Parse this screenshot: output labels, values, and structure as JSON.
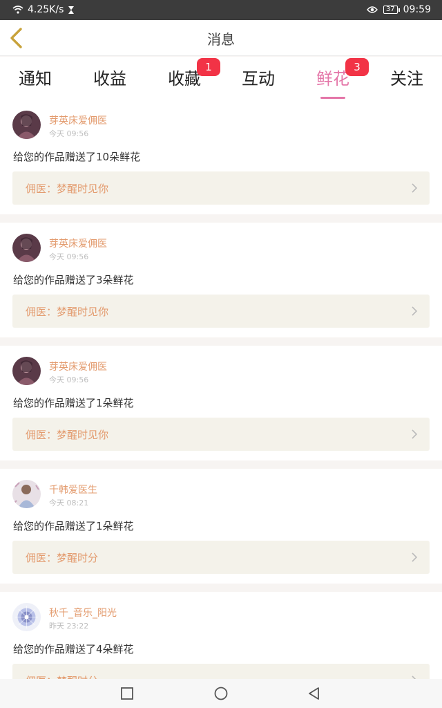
{
  "status": {
    "speed": "4.25K/s",
    "battery": "37",
    "time": "09:59"
  },
  "header": {
    "title": "消息"
  },
  "tabs": [
    {
      "label": "通知",
      "badge": ""
    },
    {
      "label": "收益",
      "badge": ""
    },
    {
      "label": "收藏",
      "badge": "1"
    },
    {
      "label": "互动",
      "badge": ""
    },
    {
      "label": "鲜花",
      "badge": "3"
    },
    {
      "label": "关注",
      "badge": ""
    }
  ],
  "active_tab": "鲜花",
  "colors": {
    "accent": "#e476a8",
    "username": "#e39b6e",
    "badge": "#f23346"
  },
  "messages": [
    {
      "user": "芽英床爱佣医",
      "time": "今天 09:56",
      "text": "给您的作品赠送了10朵鲜花",
      "work": "佣医：梦醒时见你"
    },
    {
      "user": "芽英床爱佣医",
      "time": "今天 09:56",
      "text": "给您的作品赠送了3朵鲜花",
      "work": "佣医：梦醒时见你"
    },
    {
      "user": "芽英床爱佣医",
      "time": "今天 09:56",
      "text": "给您的作品赠送了1朵鲜花",
      "work": "佣医：梦醒时见你"
    },
    {
      "user": "千韩爱医生",
      "time": "今天 08:21",
      "text": "给您的作品赠送了1朵鲜花",
      "work": "佣医：梦醒时分"
    },
    {
      "user": "秋千_音乐_阳光",
      "time": "昨天 23:22",
      "text": "给您的作品赠送了4朵鲜花",
      "work": "佣医：梦醒时分"
    }
  ]
}
